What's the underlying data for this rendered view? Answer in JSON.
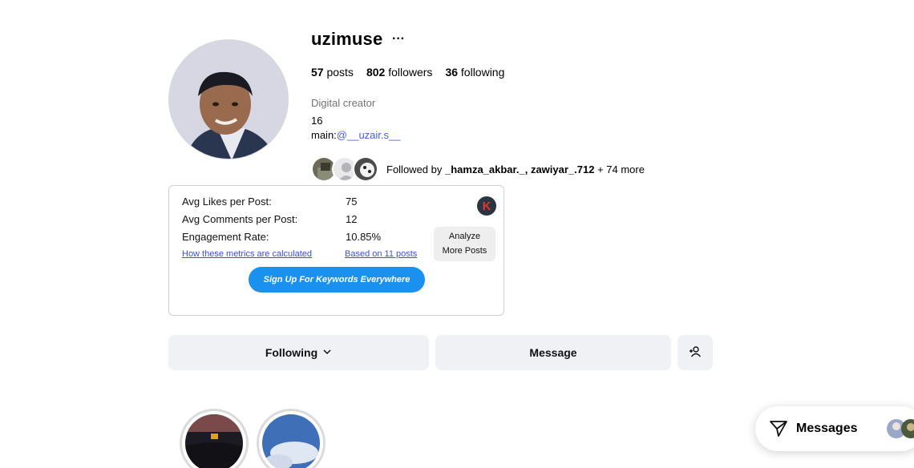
{
  "profile": {
    "username": "uzimuse",
    "stats": {
      "posts_count": "57",
      "posts_label": "posts",
      "followers_count": "802",
      "followers_label": "followers",
      "following_count": "36",
      "following_label": "following"
    },
    "bio": {
      "category": "Digital creator",
      "line1": "16",
      "line2_prefix": "main:",
      "line2_link": "@__uzair.s__"
    },
    "followed_by": {
      "prefix": "Followed by ",
      "names": "_hamza_akbar._, zawiyar_.712",
      "suffix": " + 74 more"
    }
  },
  "keywords_widget": {
    "logo_letter": "K",
    "rows": [
      {
        "label": "Avg Likes per Post:",
        "value": "75"
      },
      {
        "label": "Avg Comments per Post:",
        "value": "12"
      },
      {
        "label": "Engagement Rate:",
        "value": "10.85%"
      }
    ],
    "metrics_link": "How these metrics are calculated",
    "based_on_link": "Based on 11 posts",
    "analyze_button": "Analyze More Posts",
    "analyze_line1": "Analyze",
    "analyze_line2": "More Posts",
    "signup_button": "Sign Up For Keywords Everywhere"
  },
  "actions": {
    "following_label": "Following",
    "message_label": "Message"
  },
  "messages_pill": {
    "label": "Messages"
  },
  "icons": {
    "more": "more-horizontal-icon",
    "chevron": "chevron-down-icon",
    "add_user": "add-user-icon",
    "messages": "paper-plane-icon"
  },
  "colors": {
    "link": "#4a5ed8",
    "button_bg": "#eff1f5",
    "signup_bg": "#1a91ef",
    "secondary_text": "#737373"
  }
}
